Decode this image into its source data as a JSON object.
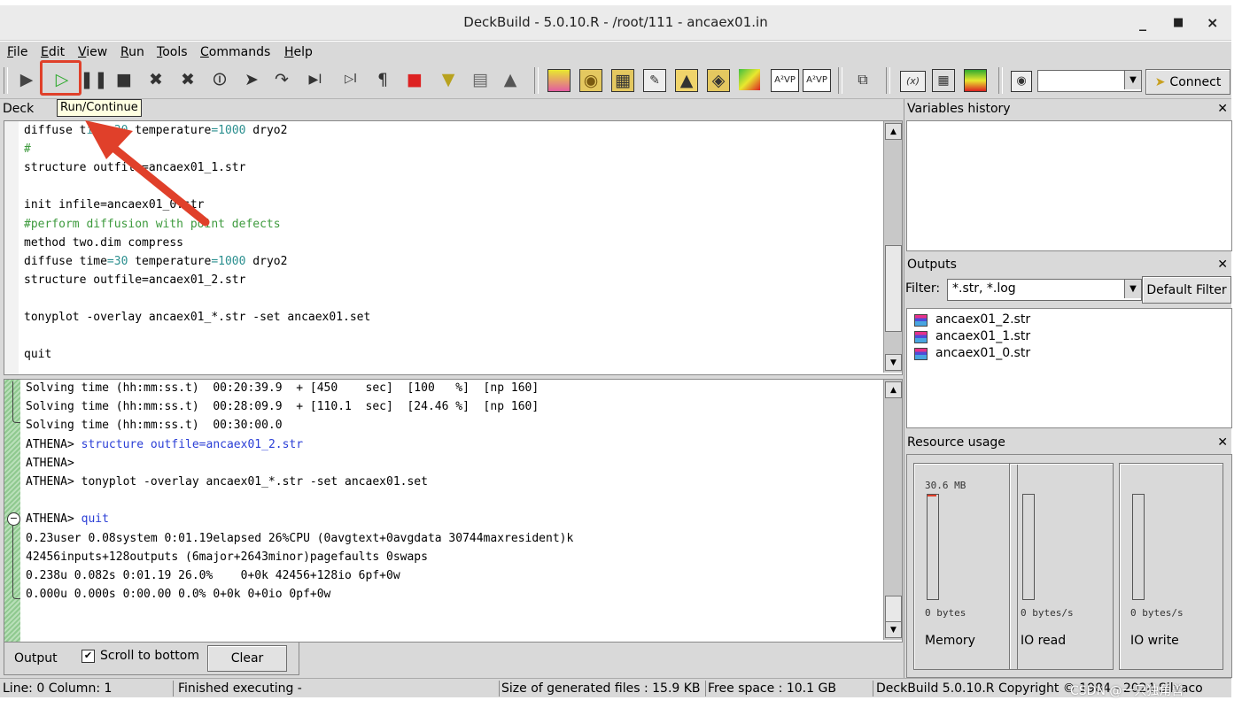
{
  "window": {
    "title": "DeckBuild - 5.0.10.R - /root/111 - ancaex01.in",
    "minimize": "_",
    "maximize": "□",
    "close": "×"
  },
  "menu": [
    "File",
    "Edit",
    "View",
    "Run",
    "Tools",
    "Commands",
    "Help"
  ],
  "toolbar": {
    "tooltip": "Run/Continue",
    "connect_label": "Connect",
    "icons": [
      "load-icon",
      "run-continue-icon",
      "pause-icon",
      "stop-icon",
      "kill-icon",
      "kill-all-icon",
      "restart-icon",
      "step-icon",
      "step-over-icon",
      "line-step-icon",
      "line-step-into-icon",
      "break-icon",
      "bookmark-icon",
      "variable-icon",
      "paste-icon",
      "extract-icon",
      "tool-1-icon",
      "tool-2-icon",
      "tool-3-icon",
      "tool-4-icon",
      "tool-5-icon",
      "tool-6-icon",
      "tool-7-icon",
      "vp-icon",
      "vp-edit-icon",
      "window-icon",
      "variables-icon",
      "status-icon",
      "gradient-icon",
      "screenshot-icon"
    ],
    "accent_red": "#e0402a"
  },
  "deck": {
    "header": "Deck",
    "lines": [
      [
        {
          "t": "diffuse t",
          "c": ""
        },
        {
          "t": "ime=30",
          "c": "teal"
        },
        {
          "t": " temperature",
          "c": ""
        },
        {
          "t": "=1000",
          "c": "teal"
        },
        {
          "t": " dryo2",
          "c": ""
        }
      ],
      [
        {
          "t": "#",
          "c": "green"
        }
      ],
      [
        {
          "t": "structure outfile=ancaex01_1.str",
          "c": ""
        }
      ],
      [
        {
          "t": "",
          "c": ""
        }
      ],
      [
        {
          "t": "init infile=ancaex01_0.str",
          "c": ""
        }
      ],
      [
        {
          "t": "#perform diffusion with point defects",
          "c": "green"
        }
      ],
      [
        {
          "t": "method two.dim compress",
          "c": ""
        }
      ],
      [
        {
          "t": "diffuse time",
          "c": ""
        },
        {
          "t": "=30",
          "c": "teal"
        },
        {
          "t": " temperature",
          "c": ""
        },
        {
          "t": "=1000",
          "c": "teal"
        },
        {
          "t": " dryo2",
          "c": ""
        }
      ],
      [
        {
          "t": "structure outfile=ancaex01_2.str",
          "c": ""
        }
      ],
      [
        {
          "t": "",
          "c": ""
        }
      ],
      [
        {
          "t": "tonyplot -overlay ancaex01_*.str -set ancaex01.set",
          "c": ""
        }
      ],
      [
        {
          "t": "",
          "c": ""
        }
      ],
      [
        {
          "t": "quit",
          "c": ""
        }
      ]
    ]
  },
  "output": {
    "lines": [
      [
        {
          "t": "Solving time (hh:mm:ss.t)  00:20:39.9  + [450    sec]  [100   %]  [np 160]",
          "c": ""
        }
      ],
      [
        {
          "t": "Solving time (hh:mm:ss.t)  00:28:09.9  + [110.1  sec]  [24.46 %]  [np 160]",
          "c": ""
        }
      ],
      [
        {
          "t": "Solving time (hh:mm:ss.t)  00:30:00.0",
          "c": ""
        }
      ],
      [
        {
          "t": "ATHENA> ",
          "c": ""
        },
        {
          "t": "structure outfile=ancaex01_2.str",
          "c": "blue"
        }
      ],
      [
        {
          "t": "ATHENA>",
          "c": ""
        }
      ],
      [
        {
          "t": "ATHENA> tonyplot -overlay ancaex01_*.str -set ancaex01.set",
          "c": ""
        }
      ],
      [
        {
          "t": "",
          "c": ""
        }
      ],
      [
        {
          "t": "ATHENA> ",
          "c": ""
        },
        {
          "t": "quit",
          "c": "blue"
        }
      ],
      [
        {
          "t": "0.23user 0.08system 0:01.19elapsed 26%CPU (0avgtext+0avgdata 30744maxresident)k",
          "c": ""
        }
      ],
      [
        {
          "t": "42456inputs+128outputs (6major+2643minor)pagefaults 0swaps",
          "c": ""
        }
      ],
      [
        {
          "t": "0.238u 0.082s 0:01.19 26.0%    0+0k 42456+128io 6pf+0w",
          "c": ""
        }
      ],
      [
        {
          "t": "0.000u 0.000s 0:00.00 0.0% 0+0k 0+0io 0pf+0w",
          "c": ""
        }
      ]
    ],
    "tab_label": "Output",
    "scroll_to_bottom": "Scroll to bottom",
    "clear_label": "Clear"
  },
  "variables": {
    "header": "Variables history"
  },
  "outputs": {
    "header": "Outputs",
    "filter_label": "Filter:",
    "filter_value": "*.str, *.log",
    "default_filter": "Default Filter",
    "files": [
      "ancaex01_2.str",
      "ancaex01_1.str",
      "ancaex01_0.str"
    ]
  },
  "resources": {
    "header": "Resource usage",
    "meters": [
      {
        "label": "Memory",
        "value": "0 bytes",
        "top_value": "30.6 MB"
      },
      {
        "label": "IO read",
        "value": "0 bytes/s",
        "top_value": ""
      },
      {
        "label": "IO write",
        "value": "0 bytes/s",
        "top_value": ""
      }
    ]
  },
  "statusbar": {
    "position": "Line: 0 Column: 1",
    "state": "Finished executing -",
    "generated": "Size of generated files : 15.9 KB",
    "free": "Free space : 10.1 GB",
    "copyright": "DeckBuild 5.0.10.R  Copyright © 1984 - 2024 Silvaco",
    "watermark": "CSDN @一只独角兽"
  }
}
